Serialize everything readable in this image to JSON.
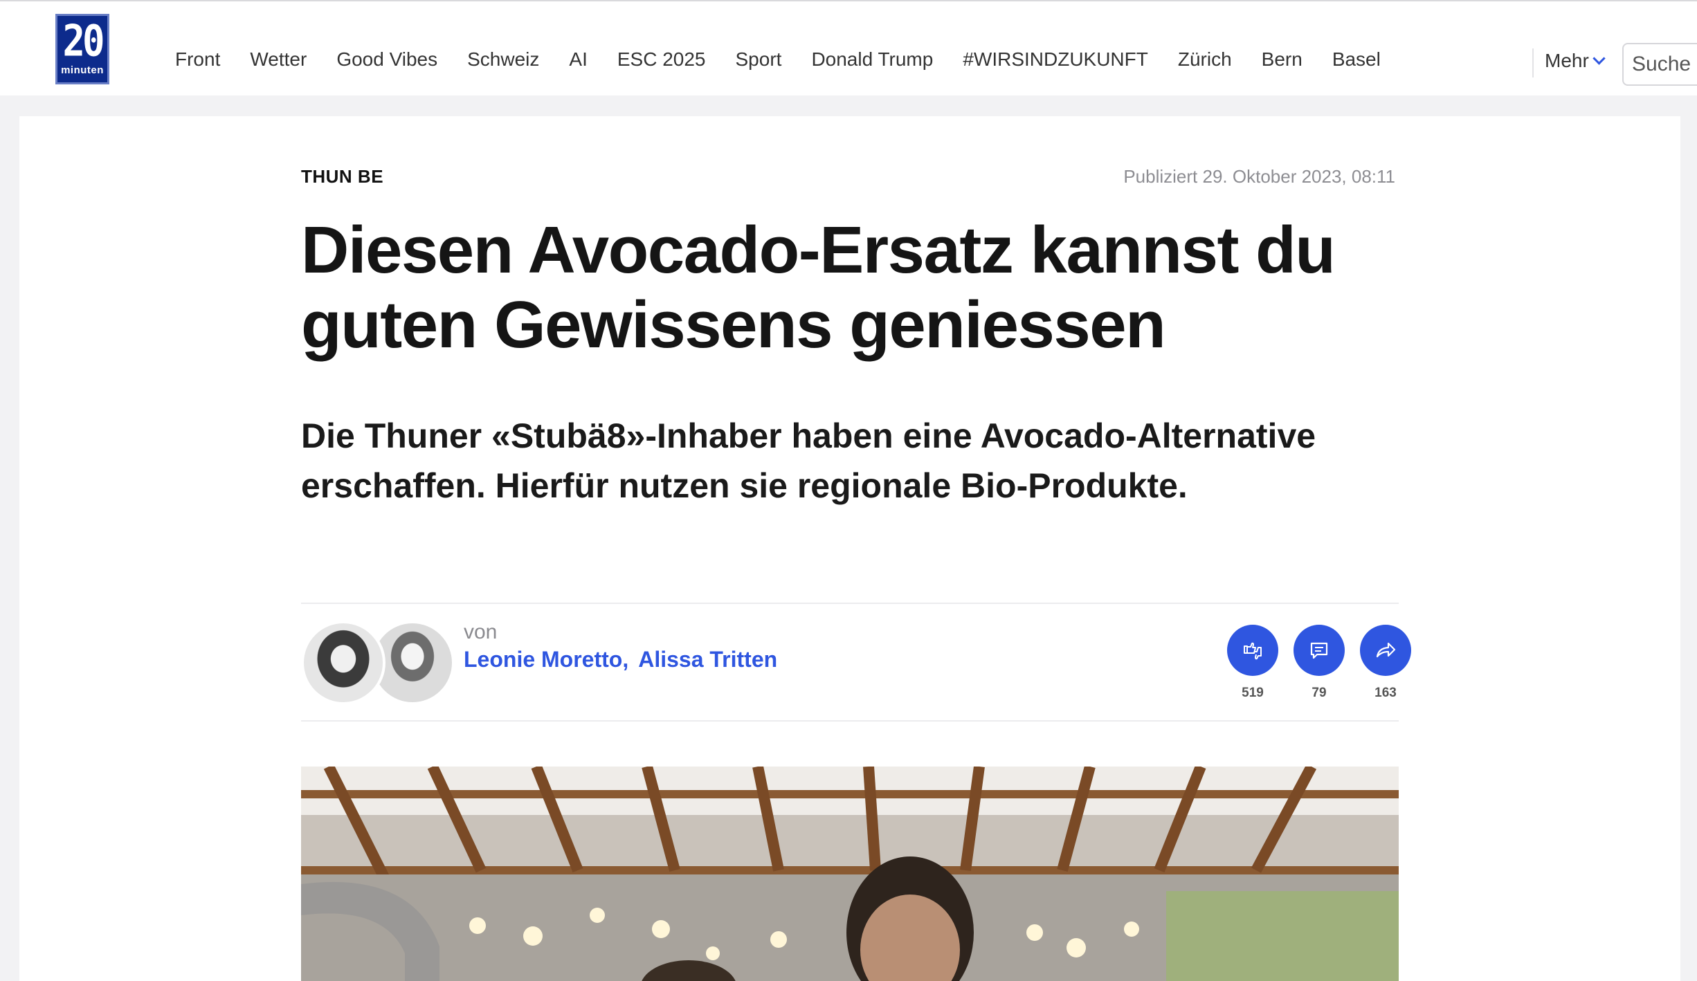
{
  "logo": {
    "number": "20",
    "word": "minuten"
  },
  "nav": {
    "items": [
      {
        "label": "Front"
      },
      {
        "label": "Wetter"
      },
      {
        "label": "Good Vibes"
      },
      {
        "label": "Schweiz"
      },
      {
        "label": "AI"
      },
      {
        "label": "ESC 2025"
      },
      {
        "label": "Sport"
      },
      {
        "label": "Donald Trump"
      },
      {
        "label": "#WIRSINDZUKUNFT"
      },
      {
        "label": "Zürich"
      },
      {
        "label": "Bern"
      },
      {
        "label": "Basel"
      }
    ],
    "more_label": "Mehr",
    "search_placeholder": "Suche"
  },
  "article": {
    "kicker": "THUN BE",
    "published": "Publiziert 29. Oktober 2023, 08:11",
    "headline": "Diesen Avocado-Ersatz kannst du guten Gewissens geniessen",
    "lead": "Die Thuner «Stubä8»-Inhaber haben eine Avocado-Alternative erschaffen. Hierfür nutzen sie  regionale Bio-Produkte.",
    "byline_prefix": "von",
    "authors": [
      "Leonie Moretto",
      "Alissa Tritten"
    ],
    "author_separator": ",",
    "actions": {
      "reactions": {
        "icon": "thumbs-up-down-icon",
        "count": "519"
      },
      "comments": {
        "icon": "comment-icon",
        "count": "79"
      },
      "share": {
        "icon": "share-arrow-icon",
        "count": "163"
      }
    }
  },
  "colors": {
    "accent": "#2f56e0",
    "logo_bg": "#0d2b8c",
    "page_bg": "#f2f2f4",
    "muted_text": "#8d8d92"
  }
}
